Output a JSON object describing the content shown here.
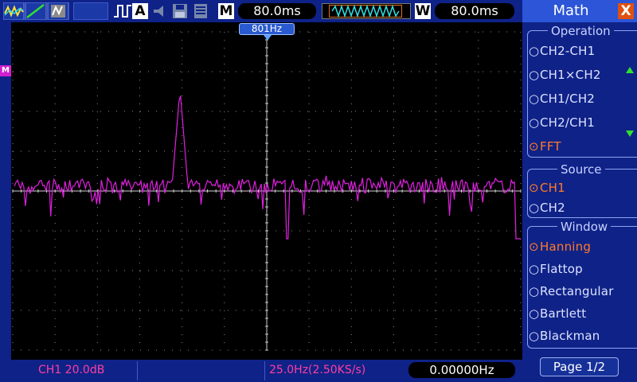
{
  "toolbar": {
    "mode_letter": "A",
    "main_letter": "M",
    "main_timebase": "80.0ms",
    "window_letter": "W",
    "window_timebase": "80.0ms",
    "icons": [
      "math-waveform-icon",
      "ch2-line-icon",
      "ref-image-icon",
      "run-stop-icon",
      "acquire-mode-icon",
      "speaker-icon",
      "save-icon",
      "memory-icon"
    ]
  },
  "screen": {
    "math_marker": "M",
    "freq_cursor_label": "801Hz",
    "trace_color": "#e020e0",
    "grid_color": "#8a8a8a"
  },
  "bottom": {
    "ch1_scale": "CH1 20.0dB",
    "timebase": "25.0Hz(2.50KS/s)",
    "trigger_freq": "0.00000Hz"
  },
  "menu": {
    "title": "Math",
    "close_label": "X",
    "operation": {
      "title": "Operation",
      "options": [
        "CH2-CH1",
        "CH1×CH2",
        "CH1/CH2",
        "CH2/CH1",
        "FFT"
      ],
      "selected": "FFT"
    },
    "source": {
      "title": "Source",
      "options": [
        "CH1",
        "CH2"
      ],
      "selected": "CH1"
    },
    "window": {
      "title": "Window",
      "options": [
        "Hanning",
        "Flattop",
        "Rectangular",
        "Bartlett",
        "Blackman"
      ],
      "selected": "Hanning"
    },
    "page_label": "Page 1/2"
  },
  "colors": {
    "panel": "#0f2288",
    "selected_option": "#ff7a2a",
    "label_pink": "#ff3fa0"
  }
}
